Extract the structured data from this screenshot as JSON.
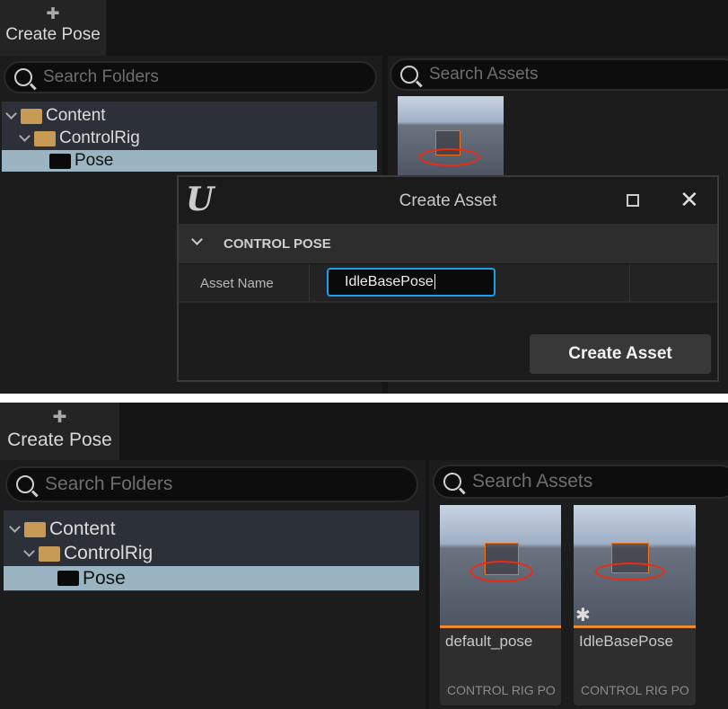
{
  "toolbar": {
    "create_pose_label": "Create Pose",
    "icon": "person-add-icon"
  },
  "folders": {
    "search_placeholder": "Search Folders",
    "items": [
      {
        "label": "Content",
        "expanded": true
      },
      {
        "label": "ControlRig",
        "expanded": true
      },
      {
        "label": "Pose",
        "selected": true
      }
    ]
  },
  "assets": {
    "search_placeholder": "Search Assets",
    "items": [
      {
        "name": "default_pose",
        "type": "CONTROL RIG PO"
      },
      {
        "name": "IdleBasePose",
        "type": "CONTROL RIG PO",
        "new": true
      }
    ]
  },
  "dialog": {
    "title": "Create Asset",
    "section": "CONTROL POSE",
    "field_label": "Asset Name",
    "field_value": "IdleBasePose",
    "create_button": "Create Asset",
    "logo": "U"
  },
  "colors": {
    "selection": "#9ab5c1",
    "accent_orange": "#f08a2c",
    "focus_blue": "#1aa0e8",
    "folder": "#c79a55"
  }
}
